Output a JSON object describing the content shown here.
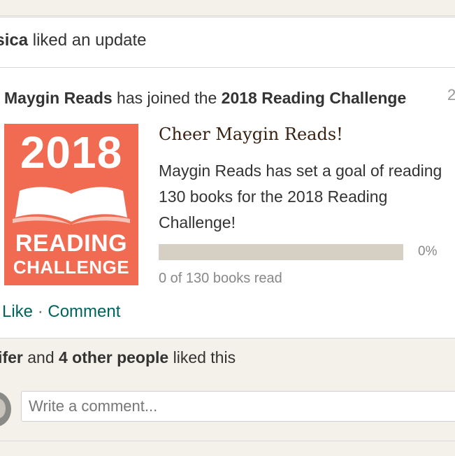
{
  "update": {
    "actor_name": "ssica",
    "action_text": " liked an update"
  },
  "post": {
    "user_name": "Maygin Reads",
    "joined_text": " has joined the ",
    "challenge_name": "2018 Reading Challenge",
    "timestamp": "2"
  },
  "badge": {
    "year": "2018",
    "title_line1": "READING",
    "title_line2": "CHALLENGE",
    "book_icon": "open-book-icon",
    "color": "#f06b52"
  },
  "challenge": {
    "cheer_title": "Cheer Maygin Reads!",
    "goal_text": "Maygin Reads has set a goal of reading 130 books for the 2018 Reading Challenge!",
    "progress_fraction": 0,
    "progress_percent": "0%",
    "books_read_text": "0 of 130 books read"
  },
  "actions": {
    "like_label": "Like",
    "separator": " · ",
    "comment_label": "Comment"
  },
  "likes": {
    "first_name": "nifer",
    "and_text": " and ",
    "others": "4 other people",
    "suffix": " liked this"
  },
  "comment": {
    "placeholder": "Write a comment..."
  },
  "colors": {
    "link": "#00635d",
    "background": "#f4f1ea",
    "progress_track": "#d6d0c4"
  }
}
